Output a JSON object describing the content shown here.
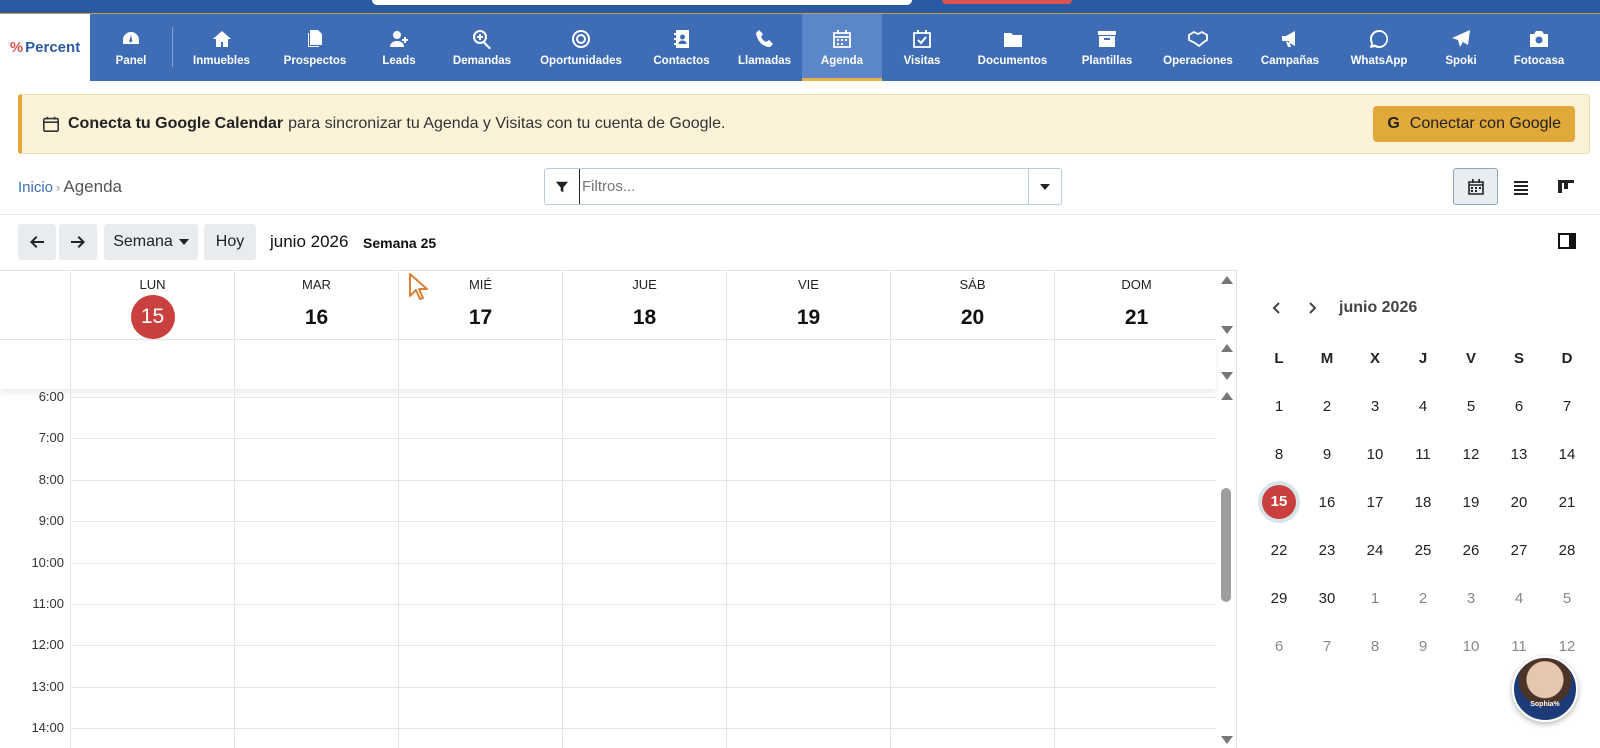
{
  "logo": {
    "text": "Percent",
    "mark": "%"
  },
  "nav": [
    {
      "label": "Panel",
      "icon": "dashboard-icon"
    },
    {
      "label": "Inmuebles",
      "icon": "home-icon"
    },
    {
      "label": "Prospectos",
      "icon": "files-icon"
    },
    {
      "label": "Leads",
      "icon": "user-plus-icon"
    },
    {
      "label": "Demandas",
      "icon": "search-plus-icon"
    },
    {
      "label": "Oportunidades",
      "icon": "target-icon"
    },
    {
      "label": "Contactos",
      "icon": "address-book-icon"
    },
    {
      "label": "Llamadas",
      "icon": "phone-icon"
    },
    {
      "label": "Agenda",
      "icon": "calendar-icon",
      "active": true
    },
    {
      "label": "Visitas",
      "icon": "calendar-check-icon"
    },
    {
      "label": "Documentos",
      "icon": "folder-icon"
    },
    {
      "label": "Plantillas",
      "icon": "archive-icon"
    },
    {
      "label": "Operaciones",
      "icon": "handshake-icon"
    },
    {
      "label": "Campañas",
      "icon": "megaphone-icon"
    },
    {
      "label": "WhatsApp",
      "icon": "whatsapp-icon"
    },
    {
      "label": "Spoki",
      "icon": "paper-plane-icon"
    },
    {
      "label": "Fotocasa",
      "icon": "camera-icon"
    }
  ],
  "banner": {
    "bold": "Conecta tu Google Calendar",
    "text": "para sincronizar tu Agenda y Visitas con tu cuenta de Google.",
    "button_label": "Conectar con Google",
    "button_icon": "G"
  },
  "breadcrumb": {
    "home": "Inicio",
    "current": "Agenda"
  },
  "filter": {
    "placeholder": "Filtros..."
  },
  "toolbar": {
    "view_label": "Semana",
    "today_label": "Hoy",
    "month_title": "junio 2026",
    "week_tag": "Semana 25"
  },
  "week": {
    "days": [
      {
        "name": "LUN",
        "num": "15",
        "today": true
      },
      {
        "name": "MAR",
        "num": "16"
      },
      {
        "name": "MIÉ",
        "num": "17"
      },
      {
        "name": "JUE",
        "num": "18"
      },
      {
        "name": "VIE",
        "num": "19"
      },
      {
        "name": "SÁB",
        "num": "20"
      },
      {
        "name": "DOM",
        "num": "21"
      }
    ],
    "hours": [
      "6:00",
      "7:00",
      "8:00",
      "9:00",
      "10:00",
      "11:00",
      "12:00",
      "13:00",
      "14:00"
    ]
  },
  "mini": {
    "title": "junio 2026",
    "headers": [
      "L",
      "M",
      "X",
      "J",
      "V",
      "S",
      "D"
    ],
    "weeks": [
      [
        [
          "1",
          0
        ],
        [
          "2",
          0
        ],
        [
          "3",
          0
        ],
        [
          "4",
          0
        ],
        [
          "5",
          0
        ],
        [
          "6",
          0
        ],
        [
          "7",
          0
        ]
      ],
      [
        [
          "8",
          0
        ],
        [
          "9",
          0
        ],
        [
          "10",
          0
        ],
        [
          "11",
          0
        ],
        [
          "12",
          0
        ],
        [
          "13",
          0
        ],
        [
          "14",
          0
        ]
      ],
      [
        [
          "15",
          2
        ],
        [
          "16",
          0
        ],
        [
          "17",
          0
        ],
        [
          "18",
          0
        ],
        [
          "19",
          0
        ],
        [
          "20",
          0
        ],
        [
          "21",
          0
        ]
      ],
      [
        [
          "22",
          0
        ],
        [
          "23",
          0
        ],
        [
          "24",
          0
        ],
        [
          "25",
          0
        ],
        [
          "26",
          0
        ],
        [
          "27",
          0
        ],
        [
          "28",
          0
        ]
      ],
      [
        [
          "29",
          0
        ],
        [
          "30",
          0
        ],
        [
          "1",
          1
        ],
        [
          "2",
          1
        ],
        [
          "3",
          1
        ],
        [
          "4",
          1
        ],
        [
          "5",
          1
        ]
      ],
      [
        [
          "6",
          1
        ],
        [
          "7",
          1
        ],
        [
          "8",
          1
        ],
        [
          "9",
          1
        ],
        [
          "10",
          1
        ],
        [
          "11",
          1
        ],
        [
          "12",
          1
        ]
      ]
    ]
  },
  "assistant": {
    "name": "Sophia%"
  },
  "colors": {
    "nav": "#3f6db5",
    "accent": "#e0a93a",
    "today": "#c9403f"
  }
}
